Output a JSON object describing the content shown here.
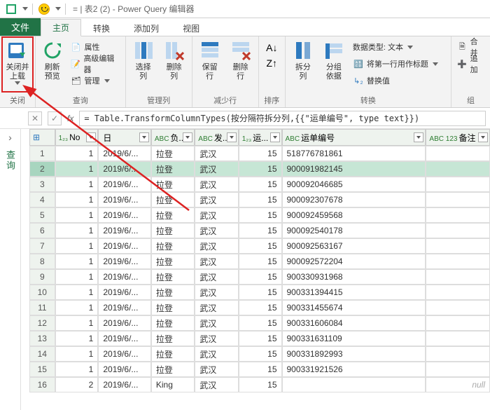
{
  "title": "表2 (2) - Power Query 编辑器",
  "tabs": {
    "file": "文件",
    "home": "主页",
    "transform": "转换",
    "addcol": "添加列",
    "view": "视图"
  },
  "ribbon": {
    "close": {
      "label": "关闭",
      "btn": "关闭并\n上载"
    },
    "query": {
      "label": "查询",
      "refresh": "刷新\n预览",
      "props": "属性",
      "adv": "高级编辑器",
      "manage": "管理"
    },
    "cols": {
      "label": "管理列",
      "choose": "选择\n列",
      "remove": "删除\n列"
    },
    "rows": {
      "label": "减少行",
      "keep": "保留\n行",
      "del": "删除\n行"
    },
    "sort": {
      "label": "排序"
    },
    "trans": {
      "label": "转换",
      "split": "拆分\n列",
      "group": "分组\n依据",
      "dtype": "数据类型: 文本",
      "firstrow": "将第一行用作标题",
      "replace": "替换值"
    },
    "comb": {
      "label": "组",
      "merge": "合并",
      "append": "追加"
    }
  },
  "leftrail": "查询",
  "formula": "= Table.TransformColumnTypes(按分隔符拆分列,{{\"运单编号\", type text}})",
  "columns": [
    "",
    "No",
    "日",
    "负...",
    "发...",
    "运...",
    "运单编号",
    "备注"
  ],
  "coltypes": [
    "",
    "1₂₃",
    "",
    "ABC",
    "ABC",
    "1₂₃",
    "ABC",
    "ABC\n123"
  ],
  "rows": [
    {
      "n": 1,
      "no": 1,
      "d": "2019/6/...",
      "p": "拉登",
      "f": "武汉",
      "q": 15,
      "code": "518776781861",
      "note": ""
    },
    {
      "n": 2,
      "no": 1,
      "d": "2019/6/...",
      "p": "拉登",
      "f": "武汉",
      "q": 15,
      "code": "900091982145",
      "note": ""
    },
    {
      "n": 3,
      "no": 1,
      "d": "2019/6/...",
      "p": "拉登",
      "f": "武汉",
      "q": 15,
      "code": "900092046685",
      "note": ""
    },
    {
      "n": 4,
      "no": 1,
      "d": "2019/6/...",
      "p": "拉登",
      "f": "武汉",
      "q": 15,
      "code": "900092307678",
      "note": ""
    },
    {
      "n": 5,
      "no": 1,
      "d": "2019/6/...",
      "p": "拉登",
      "f": "武汉",
      "q": 15,
      "code": "900092459568",
      "note": ""
    },
    {
      "n": 6,
      "no": 1,
      "d": "2019/6/...",
      "p": "拉登",
      "f": "武汉",
      "q": 15,
      "code": "900092540178",
      "note": ""
    },
    {
      "n": 7,
      "no": 1,
      "d": "2019/6/...",
      "p": "拉登",
      "f": "武汉",
      "q": 15,
      "code": "900092563167",
      "note": ""
    },
    {
      "n": 8,
      "no": 1,
      "d": "2019/6/...",
      "p": "拉登",
      "f": "武汉",
      "q": 15,
      "code": "900092572204",
      "note": ""
    },
    {
      "n": 9,
      "no": 1,
      "d": "2019/6/...",
      "p": "拉登",
      "f": "武汉",
      "q": 15,
      "code": "900330931968",
      "note": ""
    },
    {
      "n": 10,
      "no": 1,
      "d": "2019/6/...",
      "p": "拉登",
      "f": "武汉",
      "q": 15,
      "code": "900331394415",
      "note": ""
    },
    {
      "n": 11,
      "no": 1,
      "d": "2019/6/...",
      "p": "拉登",
      "f": "武汉",
      "q": 15,
      "code": "900331455674",
      "note": ""
    },
    {
      "n": 12,
      "no": 1,
      "d": "2019/6/...",
      "p": "拉登",
      "f": "武汉",
      "q": 15,
      "code": "900331606084",
      "note": ""
    },
    {
      "n": 13,
      "no": 1,
      "d": "2019/6/...",
      "p": "拉登",
      "f": "武汉",
      "q": 15,
      "code": "900331631109",
      "note": ""
    },
    {
      "n": 14,
      "no": 1,
      "d": "2019/6/...",
      "p": "拉登",
      "f": "武汉",
      "q": 15,
      "code": "900331892993",
      "note": ""
    },
    {
      "n": 15,
      "no": 1,
      "d": "2019/6/...",
      "p": "拉登",
      "f": "武汉",
      "q": 15,
      "code": "900331921526",
      "note": ""
    },
    {
      "n": 16,
      "no": 2,
      "d": "2019/6/...",
      "p": "King",
      "f": "武汉",
      "q": 15,
      "code": "",
      "note": "null"
    }
  ],
  "selectedRow": 2
}
